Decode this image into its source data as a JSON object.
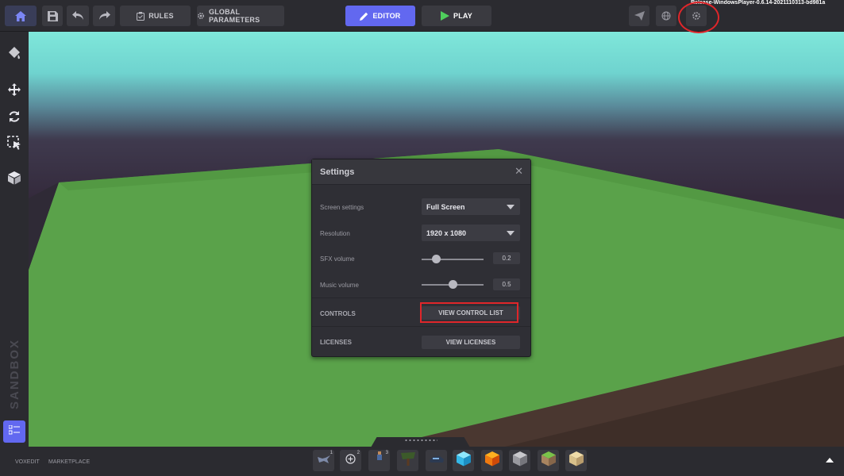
{
  "topbar": {
    "rules_label": "RULES",
    "global_label": "GLOBAL PARAMETERS",
    "editor_label": "EDITOR",
    "play_label": "PLAY",
    "build_label": "Release-WindowsPlayer-0.6.14-2021110313-bd981a",
    "accent": "#6268f0"
  },
  "sidebar": {
    "items": [
      "paint-bucket-icon",
      "move-icon",
      "rotate-icon",
      "select-icon",
      "cube-icon",
      "list-icon"
    ],
    "logo_text": "SANDBOX"
  },
  "settings": {
    "title": "Settings",
    "close": "✕",
    "screen_settings_label": "Screen settings",
    "screen_settings_value": "Full Screen",
    "resolution_label": "Resolution",
    "resolution_value": "1920 x 1080",
    "sfx_label": "SFX volume",
    "sfx_value": "0.2",
    "sfx_level": 0.2,
    "music_label": "Music volume",
    "music_value": "0.5",
    "music_level": 0.5,
    "controls_label": "CONTROLS",
    "controls_button": "VIEW CONTROL LIST",
    "licenses_label": "LICENSES",
    "licenses_button": "VIEW LICENSES"
  },
  "bottombar": {
    "voxedit": "VOXEDIT",
    "marketplace": "MARKETPLACE",
    "slots": [
      {
        "num": "1",
        "icon": "drone-icon"
      },
      {
        "num": "2",
        "icon": "add-circle-icon"
      },
      {
        "num": "3",
        "icon": "character-icon"
      },
      {
        "num": "",
        "icon": "tree-icon"
      },
      {
        "num": "",
        "icon": "vehicle-icon"
      },
      {
        "num": "",
        "icon": "ice-block-icon"
      },
      {
        "num": "",
        "icon": "lava-block-icon"
      },
      {
        "num": "",
        "icon": "stone-block-icon"
      },
      {
        "num": "",
        "icon": "grass-block-icon"
      },
      {
        "num": "",
        "icon": "sand-block-icon"
      }
    ]
  },
  "colors": {
    "highlight": "#e0262a",
    "grass": "#5aa24a",
    "sky": "#7fe7da"
  }
}
